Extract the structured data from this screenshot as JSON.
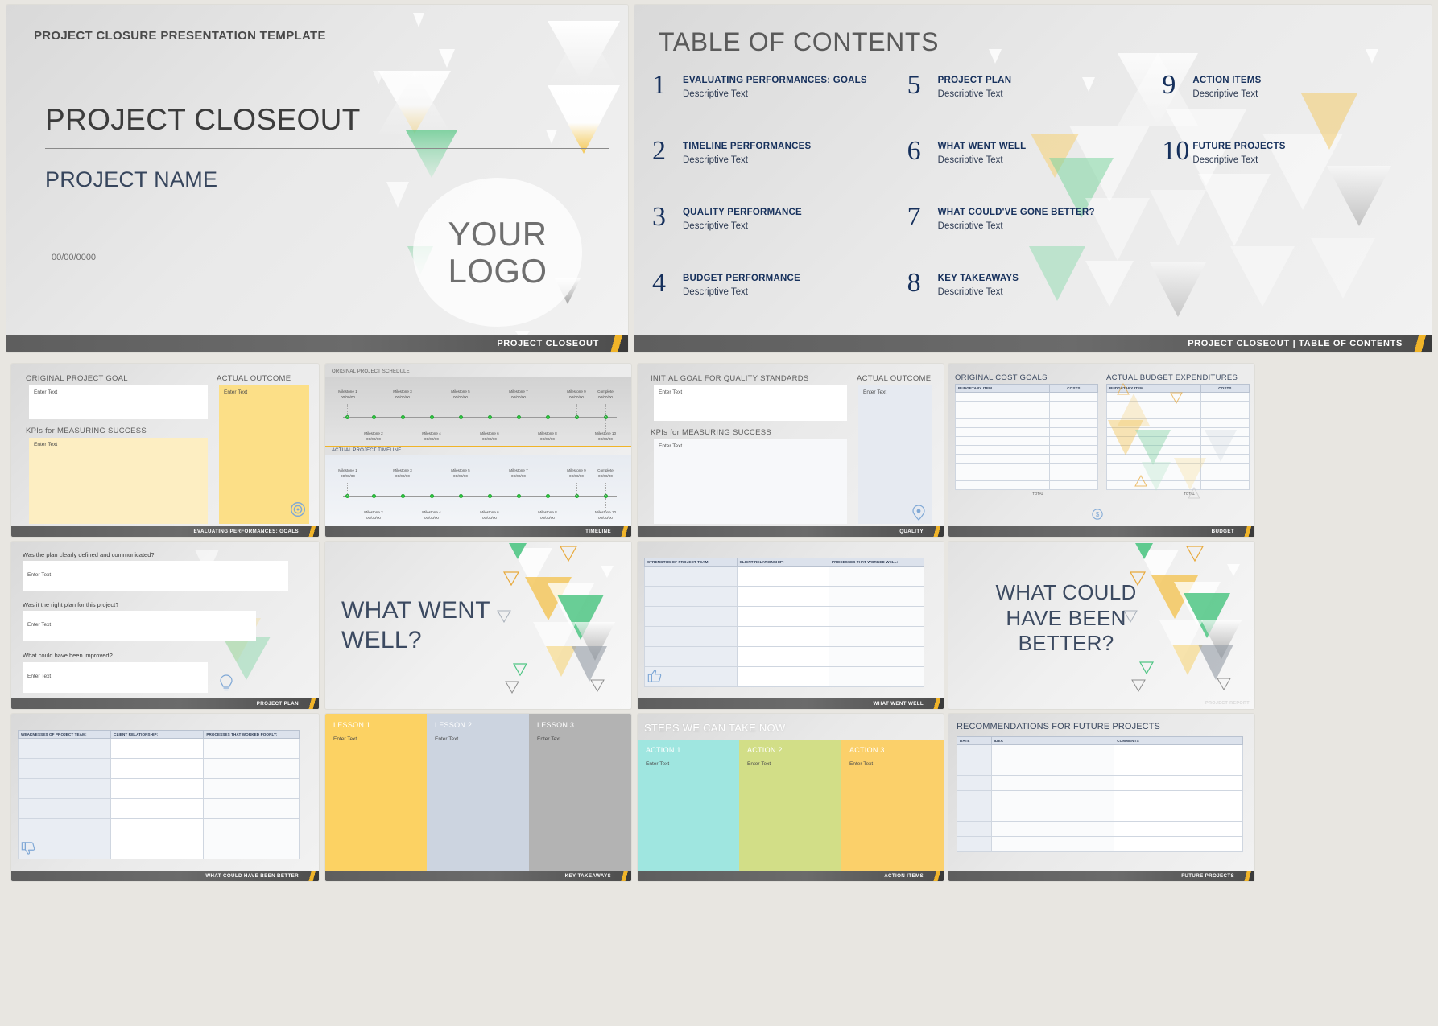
{
  "brand": {
    "accent_yellow": "#f0b429",
    "accent_green": "#5fc98a",
    "navy": "#16305c",
    "slate": "#3c4a61",
    "footer_gray": "#5e5e5e"
  },
  "title_slide": {
    "kicker": "PROJECT CLOSURE PRESENTATION TEMPLATE",
    "title": "PROJECT CLOSEOUT",
    "subtitle": "PROJECT NAME",
    "date": "00/00/0000",
    "logo_line1": "YOUR",
    "logo_line2": "LOGO",
    "footer": "PROJECT CLOSEOUT"
  },
  "toc_slide": {
    "title": "TABLE OF CONTENTS",
    "footer": "PROJECT CLOSEOUT   |   TABLE OF CONTENTS",
    "items": [
      {
        "num": "1",
        "label": "EVALUATING PERFORMANCES: GOALS",
        "desc": "Descriptive Text"
      },
      {
        "num": "5",
        "label": "PROJECT PLAN",
        "desc": "Descriptive Text"
      },
      {
        "num": "9",
        "label": "ACTION ITEMS",
        "desc": "Descriptive Text"
      },
      {
        "num": "2",
        "label": "TIMELINE PERFORMANCES",
        "desc": "Descriptive Text"
      },
      {
        "num": "6",
        "label": "WHAT WENT WELL",
        "desc": "Descriptive Text"
      },
      {
        "num": "10",
        "label": "FUTURE PROJECTS",
        "desc": "Descriptive Text"
      },
      {
        "num": "3",
        "label": "QUALITY PERFORMANCE",
        "desc": "Descriptive Text"
      },
      {
        "num": "7",
        "label": "WHAT COULD'VE GONE BETTER?",
        "desc": "Descriptive Text"
      },
      {
        "num": "",
        "label": "",
        "desc": ""
      },
      {
        "num": "4",
        "label": "BUDGET PERFORMANCE",
        "desc": "Descriptive Text"
      },
      {
        "num": "8",
        "label": "KEY TAKEAWAYS",
        "desc": "Descriptive Text"
      },
      {
        "num": "",
        "label": "",
        "desc": ""
      }
    ]
  },
  "goals_slide": {
    "h_goal": "ORIGINAL PROJECT GOAL",
    "h_outcome": "ACTUAL OUTCOME",
    "h_kpi": "KPIs for MEASURING SUCCESS",
    "placeholder": "Enter Text",
    "footer": "EVALUATING PERFORMANCES: GOALS",
    "icon": "target-icon"
  },
  "timeline_slide": {
    "h_original": "ORIGINAL PROJECT SCHEDULE",
    "h_actual": "ACTUAL PROJECT TIMELINE",
    "date_placeholder": "00/00/00",
    "top_labels": [
      "Milestone 1",
      "Milestone 3",
      "Milestone 5",
      "Milestone 7",
      "Milestone 9",
      "Complete"
    ],
    "bottom_labels": [
      "Milestone 2",
      "Milestone 4",
      "Milestone 6",
      "Milestone 8",
      "Milestone 10"
    ],
    "footer": "TIMELINE"
  },
  "quality_slide": {
    "h_goal": "INITIAL GOAL FOR QUALITY STANDARDS",
    "h_outcome": "ACTUAL OUTCOME",
    "h_kpi": "KPIs for MEASURING SUCCESS",
    "placeholder": "Enter Text",
    "footer": "QUALITY",
    "icon": "badge-icon"
  },
  "budget_slide": {
    "h_original": "ORIGINAL COST GOALS",
    "h_actual": "ACTUAL BUDGET EXPENDITURES",
    "col_item": "BUDGETARY ITEM",
    "col_cost": "COSTS",
    "total": "TOTAL",
    "footer": "BUDGET",
    "icon": "money-icon"
  },
  "plan_slide": {
    "questions": [
      "Was the plan clearly defined and communicated?",
      "Was it the right plan for this project?",
      "What could have been improved?"
    ],
    "placeholder": "Enter Text",
    "footer": "PROJECT PLAN",
    "icon": "lightbulb-icon"
  },
  "went_well_title_slide": {
    "line1": "WHAT WENT",
    "line2": "WELL?"
  },
  "went_well_slide": {
    "columns": [
      "STRENGTHS OF PROJECT TEAM:",
      "CLIENT RELATIONSHIP:",
      "PROCESSES THAT WORKED WELL:"
    ],
    "footer": "WHAT WENT WELL",
    "icon": "thumbs-up-icon"
  },
  "better_title_slide": {
    "line1": "WHAT COULD",
    "line2": "HAVE BEEN",
    "line3": "BETTER?",
    "footer": "PROJECT REPORT"
  },
  "better_slide": {
    "columns": [
      "WEAKNESSES OF PROJECT TEAM:",
      "CLIENT RELATIONSHIP:",
      "PROCESSES THAT WORKED POORLY:"
    ],
    "footer": "WHAT COULD HAVE BEEN BETTER",
    "icon": "thumbs-down-icon"
  },
  "takeaways_slide": {
    "lessons": [
      {
        "label": "LESSON 1",
        "text": "Enter Text",
        "color": "#fcd263"
      },
      {
        "label": "LESSON 2",
        "text": "Enter Text",
        "color": "#ccd4e0"
      },
      {
        "label": "LESSON 3",
        "text": "Enter Text",
        "color": "#b3b3b3"
      }
    ],
    "footer": "KEY TAKEAWAYS"
  },
  "action_slide": {
    "title": "STEPS WE CAN TAKE NOW",
    "actions": [
      {
        "label": "ACTION 1",
        "text": "Enter Text",
        "color": "#9fe6e0"
      },
      {
        "label": "ACTION 2",
        "text": "Enter Text",
        "color": "#d2de87"
      },
      {
        "label": "ACTION 3",
        "text": "Enter Text",
        "color": "#fbd06a"
      }
    ],
    "footer": "ACTION ITEMS"
  },
  "future_slide": {
    "title": "RECOMMENDATIONS FOR FUTURE PROJECTS",
    "columns": [
      "DATE",
      "IDEA",
      "COMMENTS"
    ],
    "footer": "FUTURE PROJECTS"
  }
}
